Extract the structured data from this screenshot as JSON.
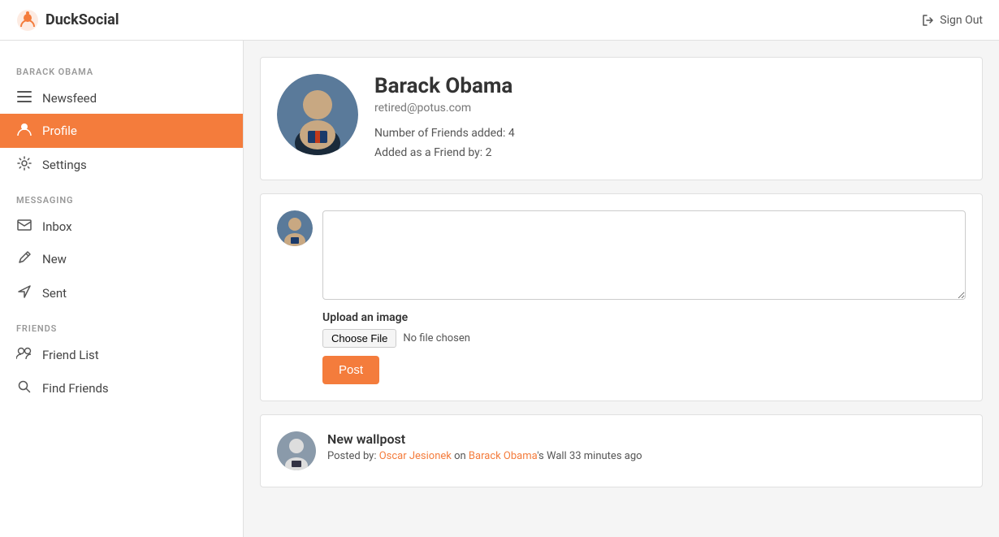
{
  "app": {
    "name": "DuckSocial",
    "sign_out_label": "Sign Out"
  },
  "sidebar": {
    "user_section_label": "BARACK OBAMA",
    "messaging_section_label": "MESSAGING",
    "friends_section_label": "FRIENDS",
    "items": [
      {
        "id": "newsfeed",
        "label": "Newsfeed",
        "icon": "☰",
        "active": false
      },
      {
        "id": "profile",
        "label": "Profile",
        "icon": "👤",
        "active": true
      },
      {
        "id": "settings",
        "label": "Settings",
        "icon": "⚙",
        "active": false
      },
      {
        "id": "inbox",
        "label": "Inbox",
        "icon": "✉",
        "active": false
      },
      {
        "id": "new",
        "label": "New",
        "icon": "✏",
        "active": false
      },
      {
        "id": "sent",
        "label": "Sent",
        "icon": "➤",
        "active": false
      },
      {
        "id": "friend-list",
        "label": "Friend List",
        "icon": "👥",
        "active": false
      },
      {
        "id": "find-friends",
        "label": "Find Friends",
        "icon": "🔍",
        "active": false
      }
    ]
  },
  "profile": {
    "name": "Barack Obama",
    "email": "retired@potus.com",
    "friends_added": "Number of Friends added: 4",
    "added_by": "Added as a Friend by: 2"
  },
  "post_form": {
    "textarea_placeholder": "",
    "upload_label": "Upload an image",
    "choose_file_label": "Choose File",
    "no_file_label": "No file chosen",
    "post_button_label": "Post"
  },
  "wallpost": {
    "title": "New wallpost",
    "meta_prefix": "Posted by: ",
    "poster_name": "Oscar Jesionek",
    "on_text": " on ",
    "wall_owner": "Barack Obama",
    "wall_suffix": "'s Wall 33 minutes ago"
  }
}
